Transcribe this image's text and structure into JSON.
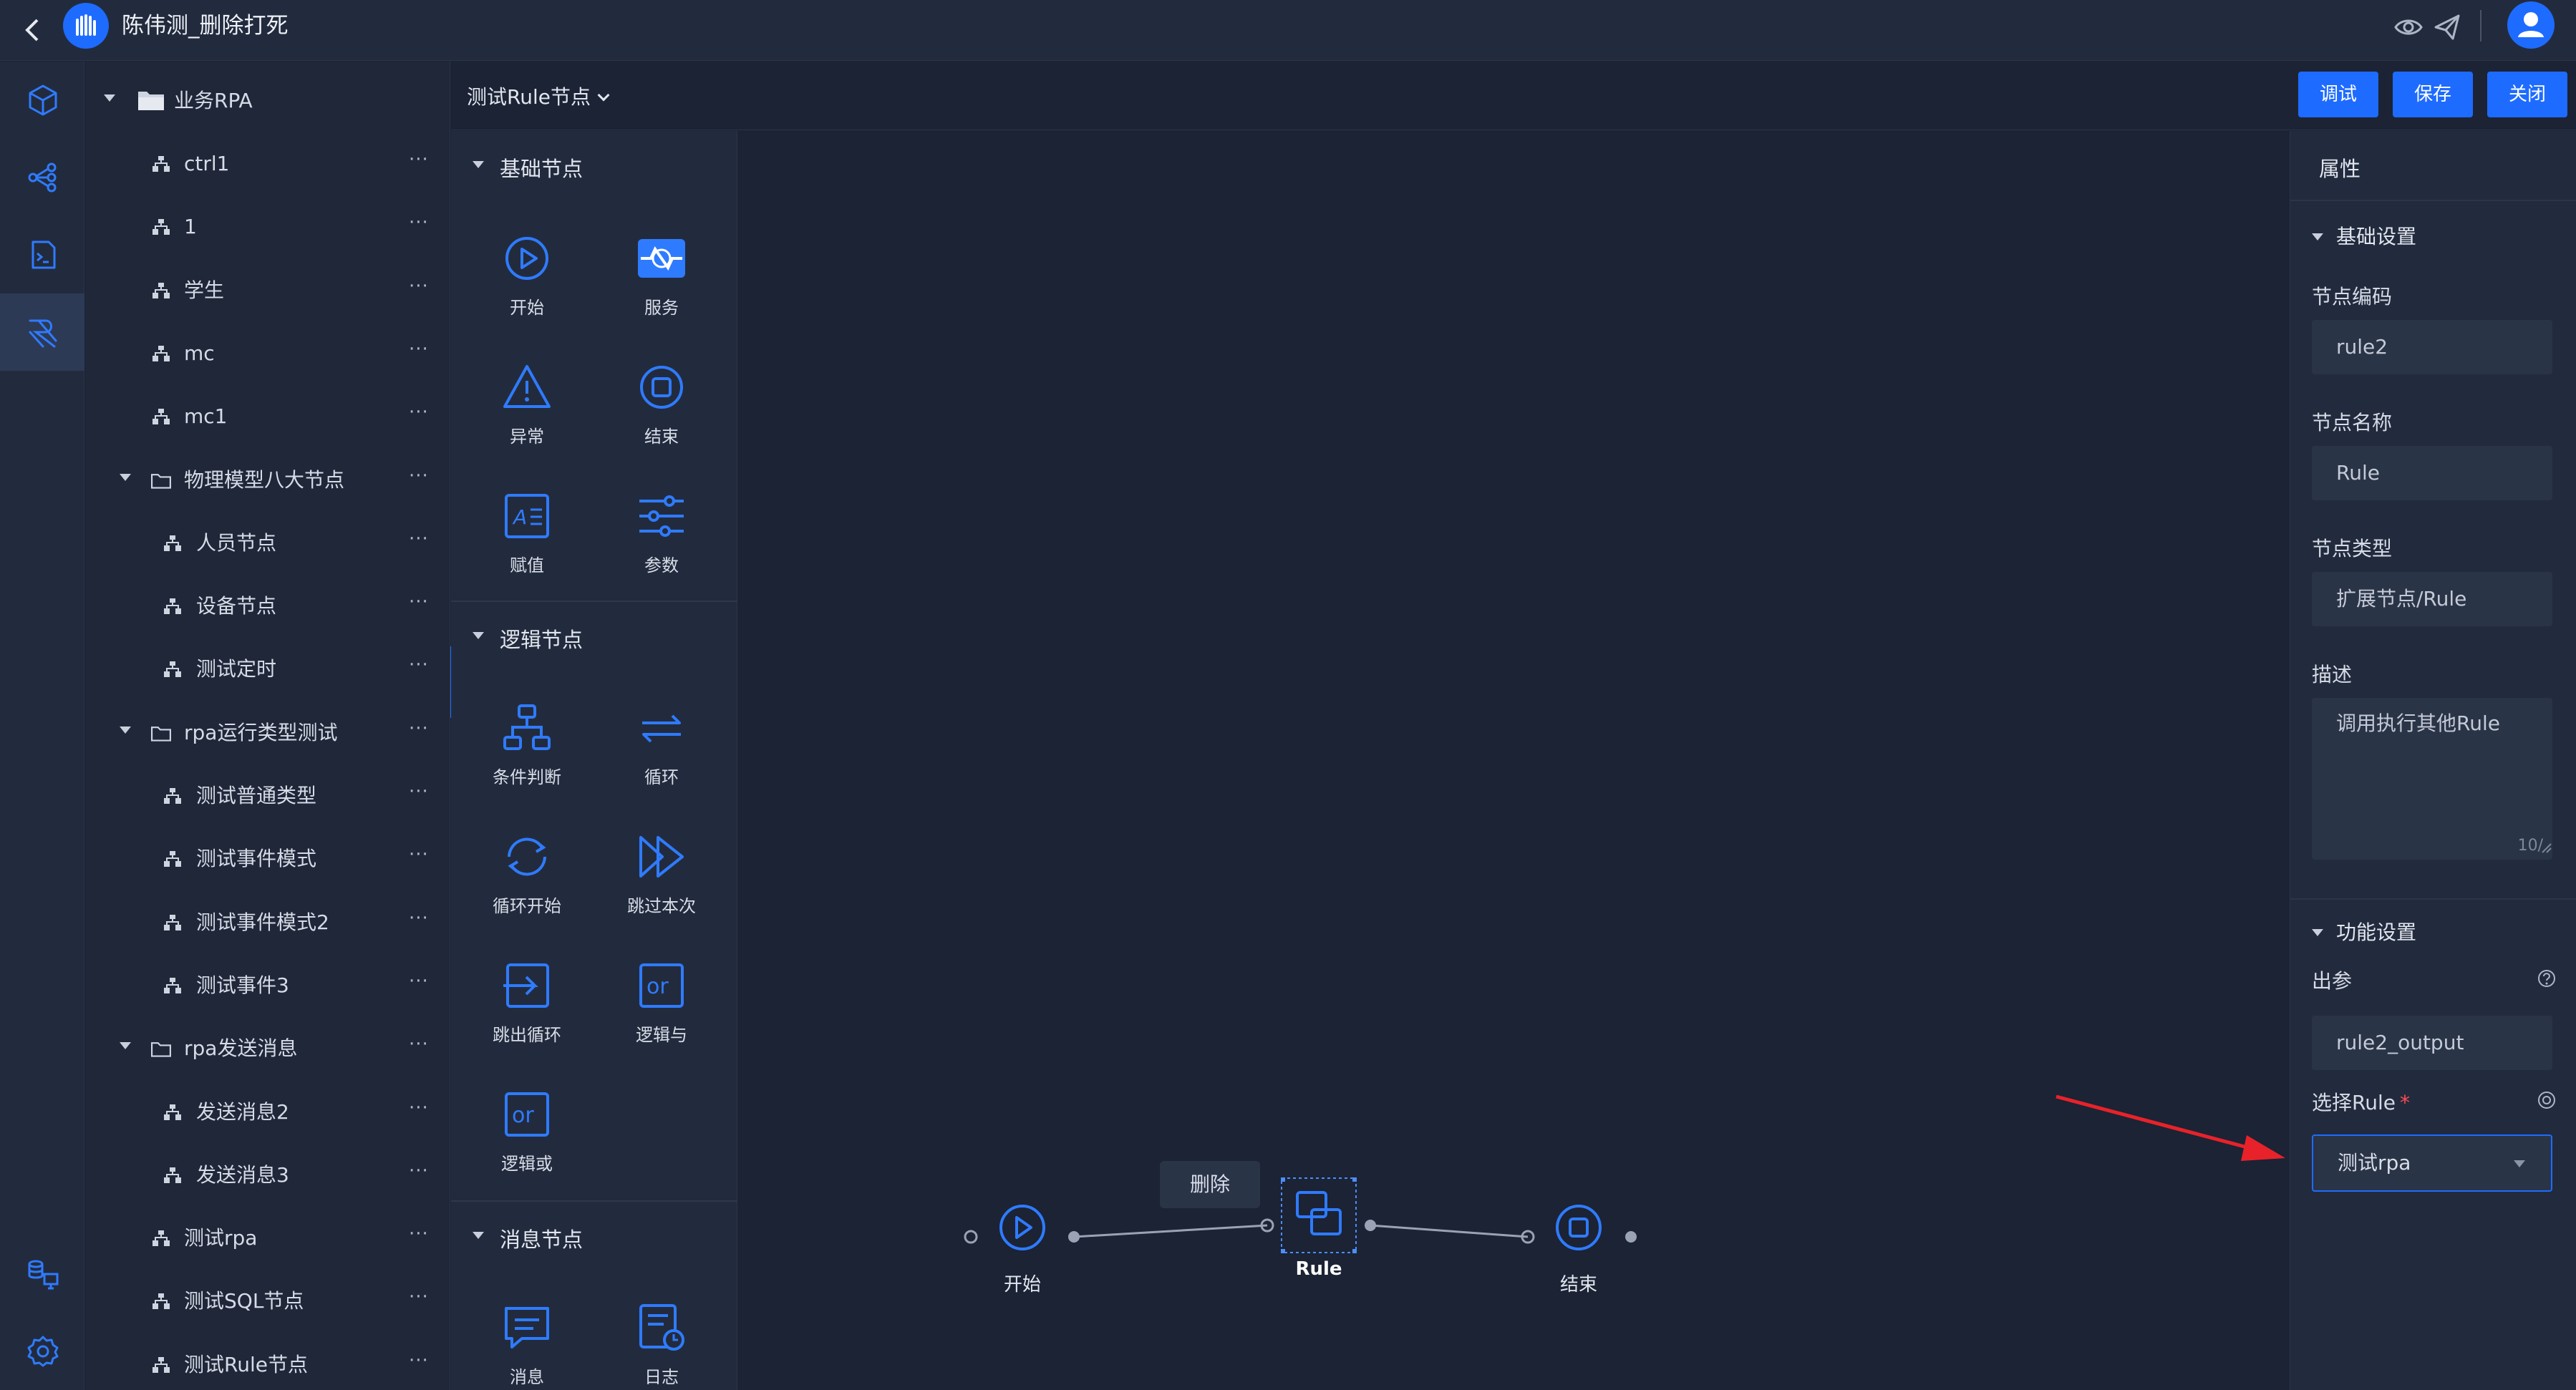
{
  "header": {
    "back_icon": "chevron-left-icon",
    "title": "陈伟测_删除打死",
    "icons": [
      "eye-icon",
      "send-icon",
      "user-avatar-icon"
    ]
  },
  "rail": [
    "cube-icon",
    "flow-share-icon",
    "script-icon",
    "rpa-icon",
    "database-monitor-icon",
    "gear-icon"
  ],
  "tree": {
    "root": "业务RPA",
    "items": [
      {
        "label": "ctrl1",
        "type": "node"
      },
      {
        "label": "1",
        "type": "node"
      },
      {
        "label": "学生",
        "type": "node"
      },
      {
        "label": "mc",
        "type": "node"
      },
      {
        "label": "mc1",
        "type": "node"
      },
      {
        "label": "物理模型八大节点",
        "type": "folder"
      },
      {
        "label": "人员节点",
        "type": "child"
      },
      {
        "label": "设备节点",
        "type": "child"
      },
      {
        "label": "测试定时",
        "type": "child"
      },
      {
        "label": "rpa运行类型测试",
        "type": "folder"
      },
      {
        "label": "测试普通类型",
        "type": "child"
      },
      {
        "label": "测试事件模式",
        "type": "child"
      },
      {
        "label": "测试事件模式2",
        "type": "child"
      },
      {
        "label": "测试事件3",
        "type": "child"
      },
      {
        "label": "rpa发送消息",
        "type": "folder"
      },
      {
        "label": "发送消息2",
        "type": "child"
      },
      {
        "label": "发送消息3",
        "type": "child"
      },
      {
        "label": "测试rpa",
        "type": "node"
      },
      {
        "label": "测试SQL节点",
        "type": "node"
      },
      {
        "label": "测试Rule节点",
        "type": "node"
      }
    ],
    "more_label": "···"
  },
  "toolbar": {
    "flow_name": "测试Rule节点",
    "debug_label": "调试",
    "save_label": "保存",
    "close_label": "关闭"
  },
  "palette": {
    "basic_title": "基础节点",
    "basic_items": [
      "开始",
      "服务",
      "异常",
      "结束",
      "赋值",
      "参数"
    ],
    "logic_title": "逻辑节点",
    "logic_items": [
      "条件判断",
      "循环",
      "循环开始",
      "跳过本次",
      "跳出循环",
      "逻辑与",
      "逻辑或"
    ],
    "message_title": "消息节点",
    "message_items": [
      "消息",
      "日志"
    ]
  },
  "canvas": {
    "delete_tooltip": "删除",
    "start_label": "开始",
    "rule_label": "Rule",
    "end_label": "结束"
  },
  "props": {
    "title": "属性",
    "basic_section": "基础设置",
    "code_label": "节点编码",
    "code_value": "rule2",
    "name_label": "节点名称",
    "name_value": "Rule",
    "type_label": "节点类型",
    "type_value": "扩展节点/Rule",
    "desc_label": "描述",
    "desc_value": "调用执行其他Rule",
    "desc_counter": "10/",
    "func_section": "功能设置",
    "output_label": "出参",
    "output_value": "rule2_output",
    "rule_label": "选择Rule",
    "required_mark": "*",
    "rule_value": "测试rpa"
  },
  "colors": {
    "accent": "#1e6bff",
    "background": "#1b2334",
    "panel": "#222b3d",
    "arrow": "#e8222a"
  }
}
